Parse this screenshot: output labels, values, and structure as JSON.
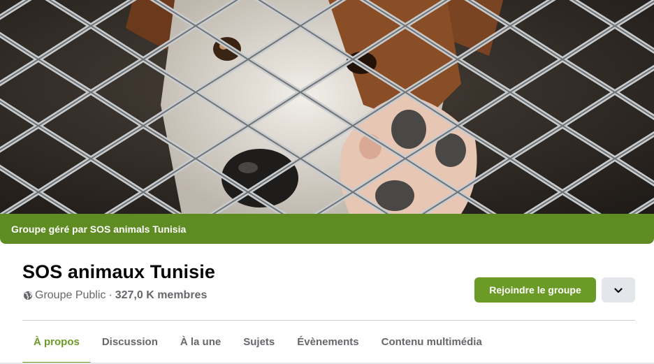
{
  "colors": {
    "accent_green": "#6b9a27",
    "managed_bar": "#5e8c22",
    "title": "#050505",
    "secondary_text": "#65676b"
  },
  "cover": {
    "image_icon": "dog-behind-fence-photo",
    "managed_by": "Groupe géré par SOS animals Tunisia"
  },
  "group": {
    "name": "SOS animaux Tunisie",
    "privacy_icon": "globe-icon",
    "privacy": "Groupe Public",
    "separator": "·",
    "members": "327,0 K membres"
  },
  "actions": {
    "join_label": "Rejoindre le groupe",
    "more_icon": "chevron-down-icon"
  },
  "tabs": [
    {
      "label": "À propos",
      "active": true
    },
    {
      "label": "Discussion",
      "active": false
    },
    {
      "label": "À la une",
      "active": false
    },
    {
      "label": "Sujets",
      "active": false
    },
    {
      "label": "Évènements",
      "active": false
    },
    {
      "label": "Contenu multimédia",
      "active": false
    }
  ]
}
